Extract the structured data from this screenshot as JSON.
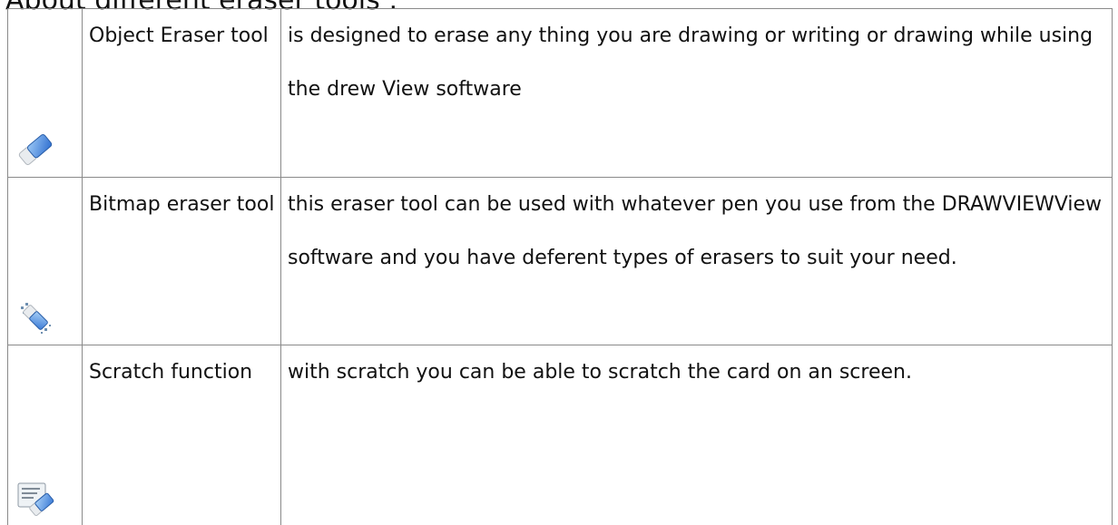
{
  "heading": "About different eraser tools :",
  "rows": [
    {
      "icon": "object-eraser-icon",
      "name": "Object Eraser tool",
      "description": "is designed to erase any thing you are drawing or writing or drawing while using the drew View software"
    },
    {
      "icon": "bitmap-eraser-icon",
      "name": "Bitmap eraser tool",
      "description": "this eraser tool can be used with whatever pen you use from the DRAWVIEWView software and you have deferent types of erasers to suit your need."
    },
    {
      "icon": "scratch-icon",
      "name": "Scratch function",
      "description": "with scratch you can be able to scratch the card on an screen."
    }
  ],
  "colors": {
    "border": "#8a8a8a",
    "eraser_blue": "#4a8fe0",
    "eraser_light": "#e8eef6"
  }
}
